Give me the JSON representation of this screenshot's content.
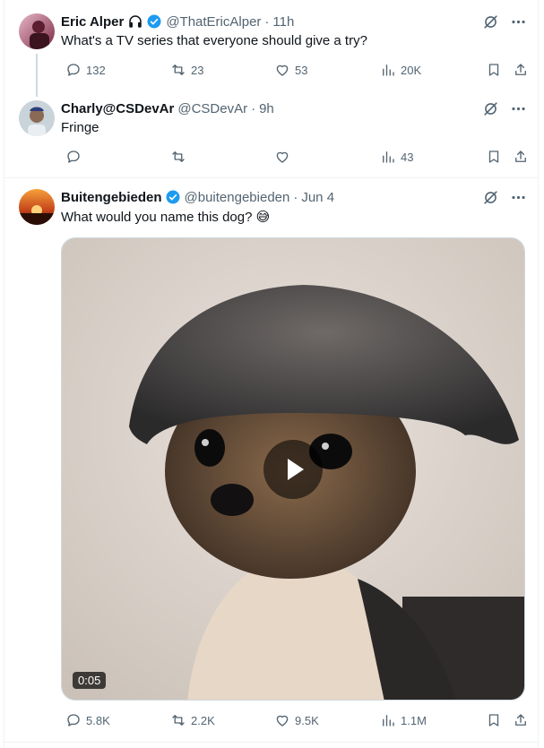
{
  "colors": {
    "verified": "#1d9bf0",
    "muted": "#536471",
    "text": "#0f1419"
  },
  "posts": [
    {
      "name": "Eric Alper",
      "handle": "@ThatEricAlper",
      "time_sep": "·",
      "time": "11h",
      "verified": true,
      "icon_after_name": "headphones-icon",
      "text": "What's a TV series that everyone should give a try?",
      "actions": {
        "replies": "132",
        "reposts": "23",
        "likes": "53",
        "views": "20K"
      }
    },
    {
      "name": "Charly@CSDevAr",
      "handle": "@CSDevAr",
      "time_sep": "·",
      "time": "9h",
      "verified": false,
      "text": "Fringe",
      "actions": {
        "replies": "",
        "reposts": "",
        "likes": "",
        "views": "43"
      }
    },
    {
      "name": "Buitengebieden",
      "handle": "@buitengebieden",
      "time_sep": "·",
      "time": "Jun 4",
      "verified": true,
      "text": "What would you name this dog? 😅",
      "media": {
        "type": "video",
        "duration": "0:05"
      },
      "actions": {
        "replies": "5.8K",
        "reposts": "2.2K",
        "likes": "9.5K",
        "views": "1.1M"
      }
    }
  ]
}
